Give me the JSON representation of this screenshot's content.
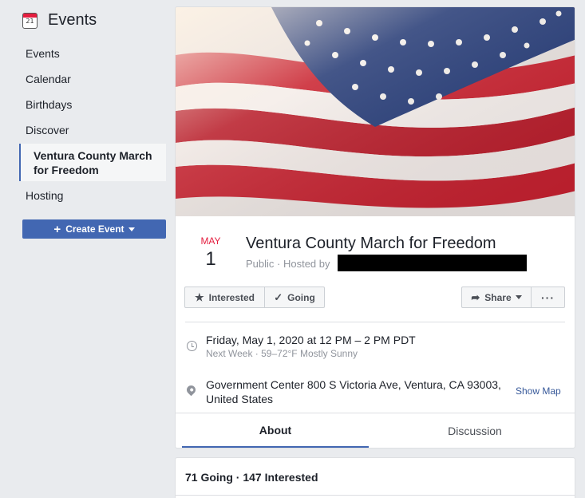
{
  "sidebar": {
    "icon_day": "21",
    "title": "Events",
    "items": [
      {
        "label": "Events"
      },
      {
        "label": "Calendar"
      },
      {
        "label": "Birthdays"
      },
      {
        "label": "Discover"
      }
    ],
    "active_item": "Ventura County March for Freedom",
    "hosting": "Hosting",
    "create_button": "Create Event"
  },
  "event": {
    "month": "MAY",
    "day": "1",
    "title": "Ventura County March for Freedom",
    "host_line": "Public · Hosted by",
    "datetime": "Friday, May 1, 2020 at 12 PM – 2 PM PDT",
    "datetime_sub": "Next Week · 59–72°F Mostly Sunny",
    "location": "Government Center 800 S Victoria Ave, Ventura, CA 93003, United States",
    "show_map": "Show Map"
  },
  "actions": {
    "interested": "Interested",
    "going": "Going",
    "share": "Share",
    "more": "···"
  },
  "tabs": {
    "about": "About",
    "discussion": "Discussion"
  },
  "stats": "71 Going · 147 Interested",
  "colors": {
    "accent": "#4267b2",
    "month_red": "#e41e3f",
    "link": "#365899"
  },
  "icons": [
    "calendar-icon",
    "plus-icon",
    "star-icon",
    "check-icon",
    "share-arrow-icon",
    "clock-icon",
    "location-pin-icon"
  ]
}
